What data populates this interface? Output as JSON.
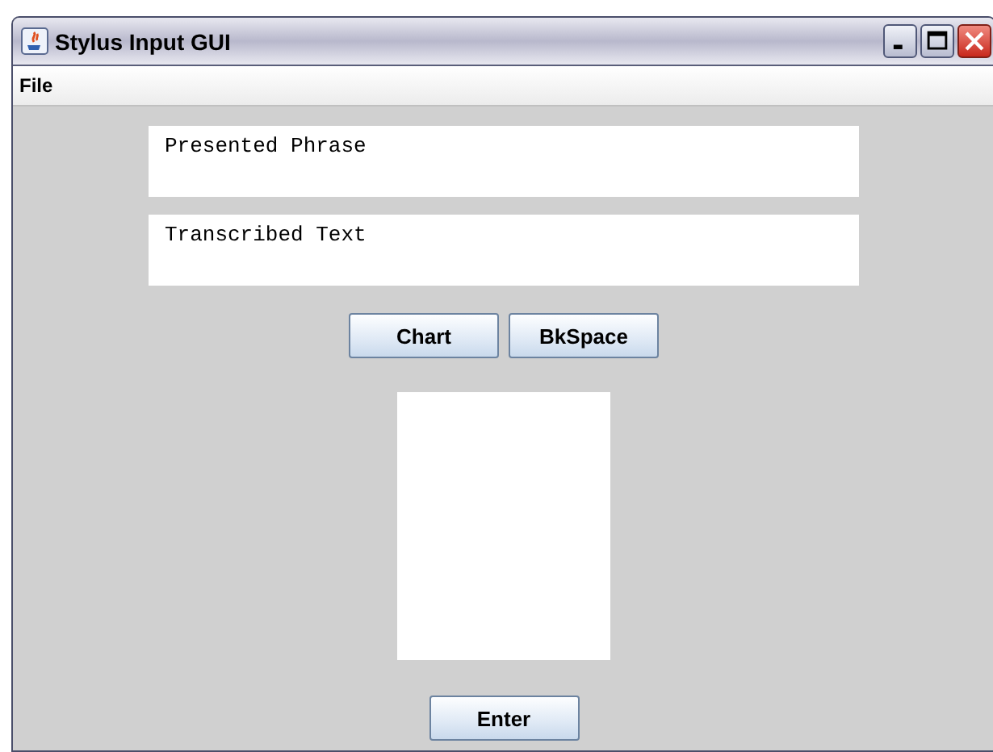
{
  "window": {
    "title": "Stylus Input GUI"
  },
  "menu": [
    "File"
  ],
  "fields": [
    {
      "text": "Presented Phrase"
    },
    {
      "text": "Transcribed Text"
    }
  ],
  "buttons": [
    "Chart",
    "BkSpace"
  ],
  "enter_button": "Enter"
}
